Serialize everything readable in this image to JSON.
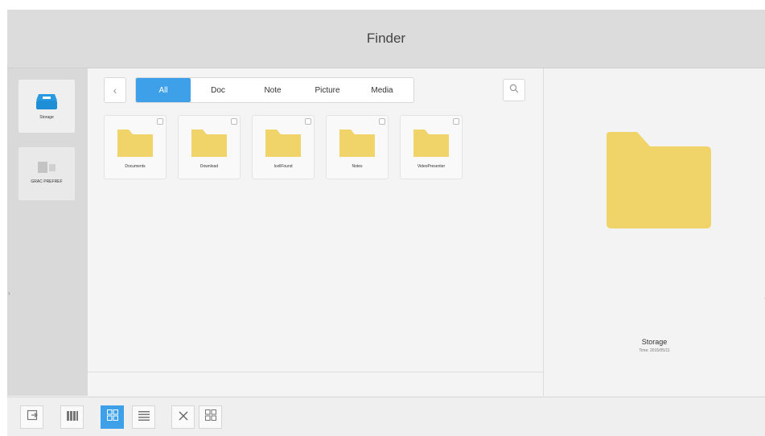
{
  "window": {
    "title": "Finder"
  },
  "sidebar": {
    "items": [
      {
        "label": "Storage",
        "icon": "storage-icon"
      },
      {
        "label": "GRAC PREFREF",
        "icon": "device-icon"
      }
    ]
  },
  "main": {
    "tabs": [
      {
        "label": "All",
        "active": true
      },
      {
        "label": "Doc",
        "active": false
      },
      {
        "label": "Note",
        "active": false
      },
      {
        "label": "Picture",
        "active": false
      },
      {
        "label": "Media",
        "active": false
      }
    ],
    "files": [
      {
        "name": "Documents"
      },
      {
        "name": "Download"
      },
      {
        "name": "IcellFound"
      },
      {
        "name": "Notes"
      },
      {
        "name": "VideoPresenter"
      }
    ]
  },
  "preview": {
    "name": "Storage",
    "time": "Time: 2015/05/11"
  },
  "toolbar": {
    "buttons": [
      "exit-icon",
      "multi-select-icon",
      "grid-view-icon",
      "list-view-icon",
      "close-icon",
      "select-all-icon"
    ]
  },
  "colors": {
    "accent": "#3da0e8",
    "folder": "#f0d46a",
    "storage": "#1e8fd6"
  }
}
